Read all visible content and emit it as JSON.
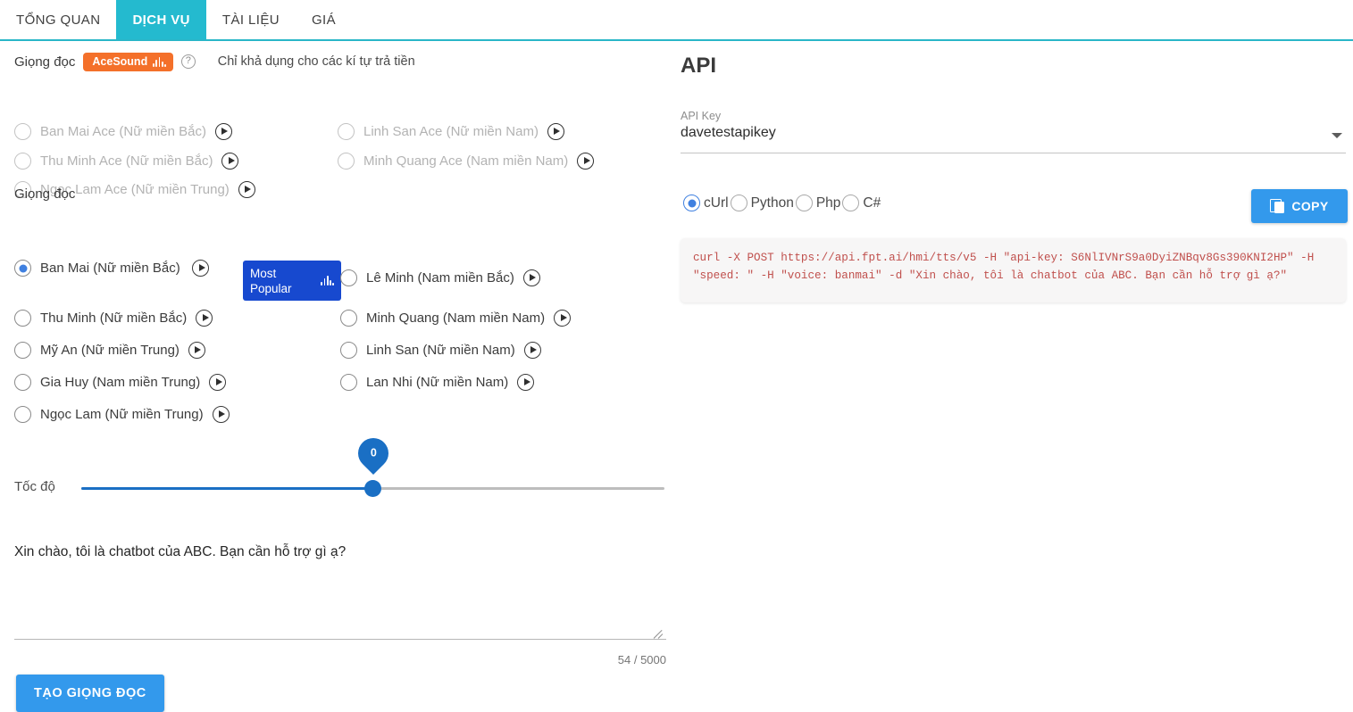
{
  "tabs": [
    {
      "label": "TỔNG QUAN",
      "active": false
    },
    {
      "label": "DỊCH VỤ",
      "active": true
    },
    {
      "label": "TÀI LIỆU",
      "active": false
    },
    {
      "label": "GIÁ",
      "active": false
    }
  ],
  "left": {
    "section1": {
      "label": "Giọng đọc",
      "badge": "AceSound",
      "hint": "Chỉ khả dụng cho các kí tự trả tiền",
      "help_icon": "?",
      "voices": [
        {
          "label": "Ban Mai Ace (Nữ miền Bắc)",
          "selected": false,
          "disabled": true
        },
        {
          "label": "Thu Minh Ace (Nữ miền Bắc)",
          "selected": false,
          "disabled": true
        },
        {
          "label": "Ngọc Lam Ace (Nữ miền Trung)",
          "selected": false,
          "disabled": true
        },
        {
          "label": "Linh San Ace (Nữ miền Nam)",
          "selected": false,
          "disabled": true
        },
        {
          "label": "Minh Quang Ace (Nam miền Nam)",
          "selected": false,
          "disabled": true
        }
      ]
    },
    "section2": {
      "label": "Giọng đọc",
      "popular_badge": "Most Popular",
      "voices": [
        {
          "label": "Ban Mai (Nữ miền Bắc)",
          "selected": true
        },
        {
          "label": "Thu Minh (Nữ miền Bắc)",
          "selected": false
        },
        {
          "label": "Mỹ An (Nữ miền Trung)",
          "selected": false
        },
        {
          "label": "Gia Huy (Nam miền Trung)",
          "selected": false
        },
        {
          "label": "Ngọc Lam (Nữ miền Trung)",
          "selected": false
        },
        {
          "label": "Lê Minh (Nam miền Bắc)",
          "selected": false
        },
        {
          "label": "Minh Quang (Nam miền Nam)",
          "selected": false
        },
        {
          "label": "Linh San (Nữ miền Nam)",
          "selected": false
        },
        {
          "label": "Lan Nhi (Nữ miền Nam)",
          "selected": false
        }
      ]
    },
    "speed": {
      "label": "Tốc độ",
      "value": "0",
      "min": -3,
      "max": 3
    },
    "text_input": {
      "value": "Xin chào, tôi là chatbot của ABC. Bạn cần hỗ trợ gì ạ?",
      "placeholder": "",
      "counter": "54 / 5000"
    },
    "generate_button": "TẠO GIỌNG ĐỌC"
  },
  "right": {
    "title": "API",
    "api_key_label": "API Key",
    "api_key_value": "davetestapikey",
    "languages": [
      {
        "label": "cUrl",
        "selected": true
      },
      {
        "label": "Python",
        "selected": false
      },
      {
        "label": "Php",
        "selected": false
      },
      {
        "label": "C#",
        "selected": false
      }
    ],
    "copy_button": "COPY",
    "code": "curl -X POST https://api.fpt.ai/hmi/tts/v5 -H \"api-key: S6NlIVNrS9a0DyiZNBqv8Gs390KNI2HP\" -H \"speed: \" -H \"voice: banmai\" -d \"Xin chào, tôi là chatbot của ABC. Bạn cần hỗ trợ gì ạ?\""
  },
  "colors": {
    "tab_active": "#24bacf",
    "badge_ace": "#f4702a",
    "badge_popular": "#1749cf",
    "primary_blue": "#3399ec",
    "slider_blue": "#1a6fc4",
    "radio_blue": "#3f80e0",
    "code_text": "#c0504d"
  }
}
